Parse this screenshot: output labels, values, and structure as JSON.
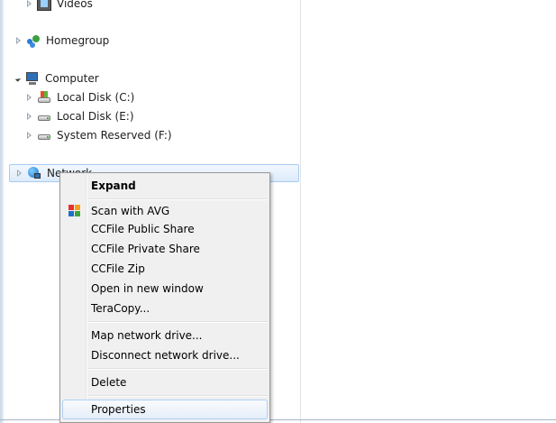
{
  "tree": {
    "videos": "Videos",
    "homegroup": "Homegroup",
    "computer": "Computer",
    "local_disk_c": "Local Disk (C:)",
    "local_disk_e": "Local Disk (E:)",
    "system_reserved_f": "System Reserved (F:)",
    "network": "Network"
  },
  "context_menu": {
    "expand": "Expand",
    "scan_avg": "Scan with AVG",
    "ccfile_public": "CCFile Public Share",
    "ccfile_private": "CCFile Private Share",
    "ccfile_zip": "CCFile Zip",
    "open_new_window": "Open in new window",
    "teracopy": "TeraCopy...",
    "map_drive": "Map network drive...",
    "disconnect_drive": "Disconnect network drive...",
    "delete": "Delete",
    "properties": "Properties"
  }
}
